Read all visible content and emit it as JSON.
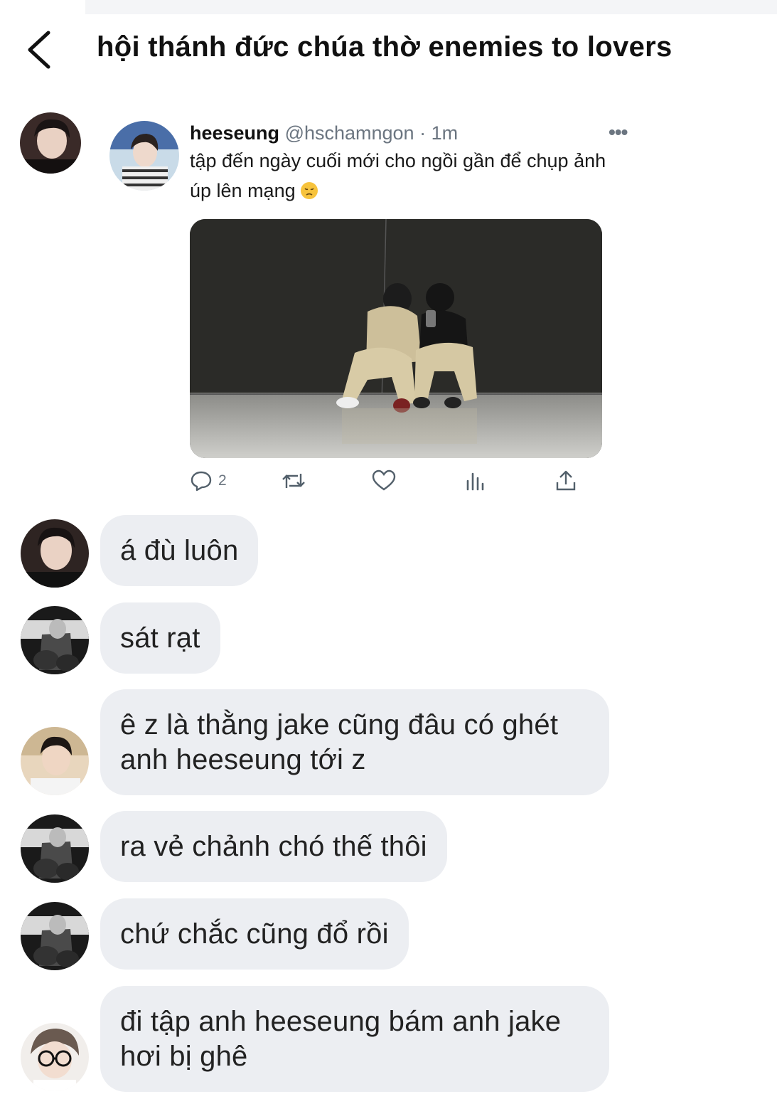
{
  "header": {
    "title": "hội thánh đức chúa thờ enemies to lovers"
  },
  "tweet": {
    "name": "heeseung",
    "meta": "@hschamngon · 1m",
    "text": "tập đến ngày cuối mới cho ngồi gần để chụp ảnh úp lên mạng",
    "reply_count": "2",
    "icons": [
      "reply-icon",
      "retweet-icon",
      "like-icon",
      "views-icon",
      "share-icon"
    ]
  },
  "messages": [
    {
      "text": "á đù luôn"
    },
    {
      "text": "sát rạt"
    },
    {
      "text": "ê z là thằng jake cũng đâu có ghét anh heeseung tới z"
    },
    {
      "text": "ra vẻ chảnh chó thế thôi"
    },
    {
      "text": "chứ chắc cũng đổ rồi"
    },
    {
      "text": "đi tập anh heeseung bám anh jake hơi bị ghê"
    }
  ],
  "colors": {
    "bubble": "#eceef2",
    "muted": "#6b7580",
    "text": "#111111"
  }
}
